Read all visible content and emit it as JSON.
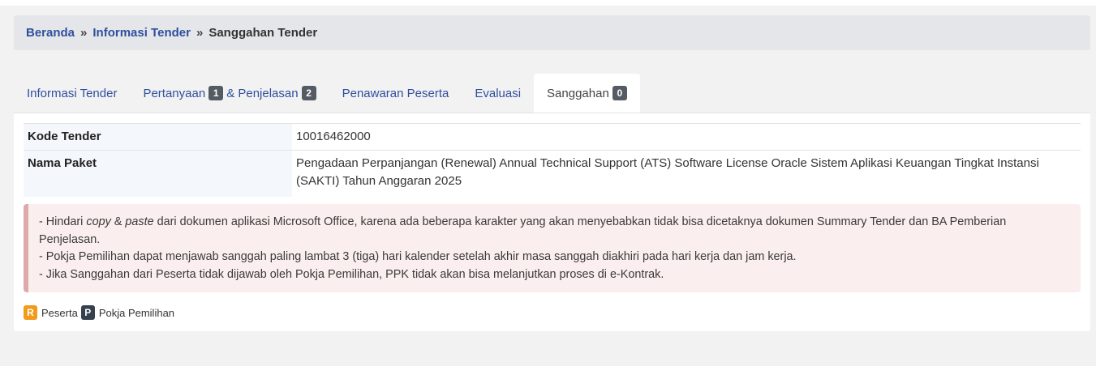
{
  "breadcrumb": {
    "items": [
      "Beranda",
      "Informasi Tender",
      "Sanggahan Tender"
    ],
    "separator": "»"
  },
  "tabs": [
    {
      "label": "Informasi Tender"
    },
    {
      "label": "Pertanyaan",
      "badge": "1",
      "label2": "& Penjelasan",
      "badge2": "2"
    },
    {
      "label": "Penawaran Peserta"
    },
    {
      "label": "Evaluasi"
    },
    {
      "label": "Sanggahan",
      "badge": "0",
      "active": true
    }
  ],
  "info": {
    "kode_label": "Kode Tender",
    "kode_value": "10016462000",
    "nama_label": "Nama Paket",
    "nama_value": "Pengadaan Perpanjangan (Renewal) Annual Technical Support (ATS) Software License Oracle Sistem Aplikasi Keuangan Tingkat Instansi (SAKTI) Tahun Anggaran 2025"
  },
  "notice": {
    "line1_prefix": "- Hindari ",
    "line1_copy": "copy",
    "line1_amp": " & ",
    "line1_paste": "paste",
    "line1_rest": " dari dokumen aplikasi Microsoft Office, karena ada beberapa karakter yang akan menyebabkan tidak bisa dicetaknya dokumen Summary Tender dan BA Pemberian Penjelasan.",
    "line2": "- Pokja Pemilihan dapat menjawab sanggah paling lambat 3 (tiga) hari kalender setelah akhir masa sanggah diakhiri pada hari kerja dan jam kerja.",
    "line3": "- Jika Sanggahan dari Peserta tidak dijawab oleh Pokja Pemilihan, PPK tidak akan bisa melanjutkan proses di e-Kontrak."
  },
  "legend": [
    {
      "badge": "R",
      "label": "Peserta",
      "color": "#f29a1b"
    },
    {
      "badge": "P",
      "label": "Pokja Pemilihan",
      "color": "#36404e"
    }
  ],
  "colors": {
    "link": "#2f4f9e",
    "badge": "#555b63",
    "alert_bg": "#fbeeee",
    "alert_border": "#dcaaaa"
  }
}
